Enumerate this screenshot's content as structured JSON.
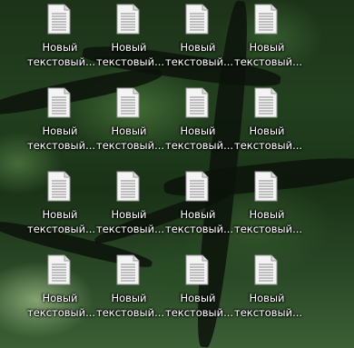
{
  "desktop": {
    "icons": [
      {
        "label": "Новый\nтекстовый..."
      },
      {
        "label": "Новый\nтекстовый..."
      },
      {
        "label": "Новый\nтекстовый..."
      },
      {
        "label": "Новый\nтекстовый..."
      },
      {
        "label": "Новый\nтекстовый..."
      },
      {
        "label": "Новый\nтекстовый..."
      },
      {
        "label": "Новый\nтекстовый..."
      },
      {
        "label": "Новый\nтекстовый..."
      },
      {
        "label": "Новый\nтекстовый..."
      },
      {
        "label": "Новый\nтекстовый..."
      },
      {
        "label": "Новый\nтекстовый..."
      },
      {
        "label": "Новый\nтекстовый..."
      },
      {
        "label": "Новый\nтекстовый..."
      },
      {
        "label": "Новый\nтекстовый..."
      },
      {
        "label": "Новый\nтекстовый..."
      },
      {
        "label": "Новый\nтекстовый..."
      }
    ],
    "icon_name": "text-document-icon"
  }
}
